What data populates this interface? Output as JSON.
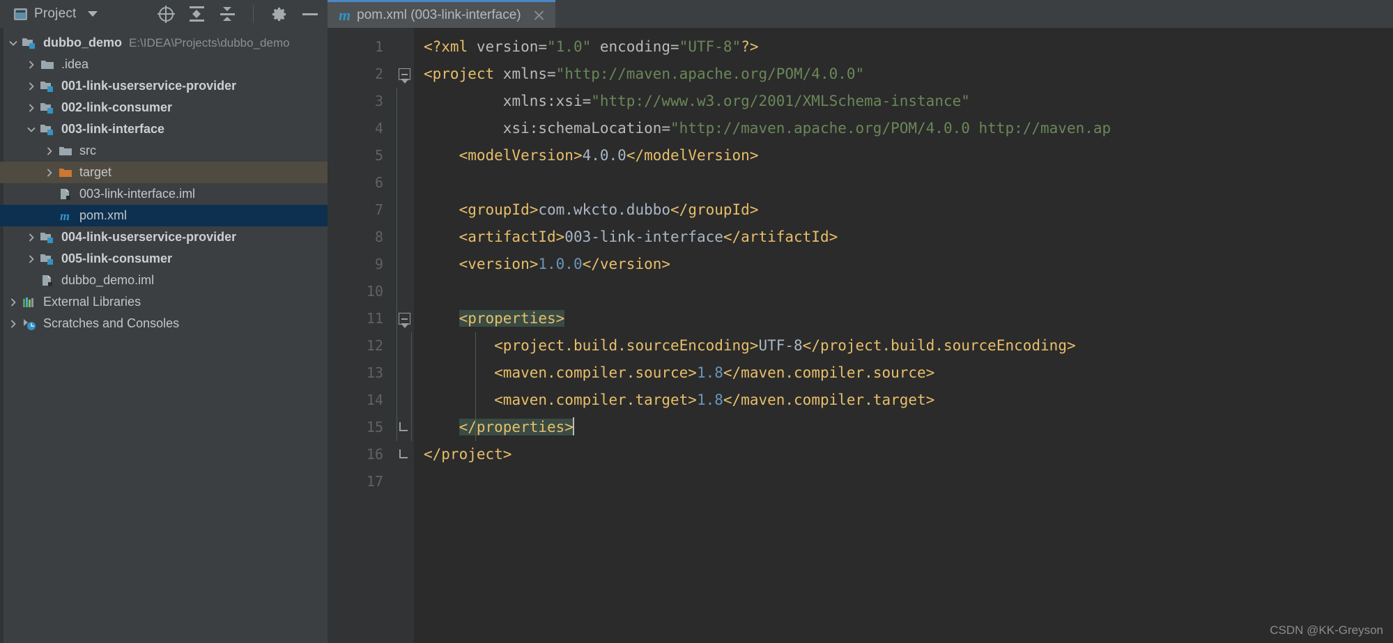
{
  "tool_window": {
    "title": "Project",
    "icons": [
      {
        "name": "locate-icon",
        "label": "Select Opened File"
      },
      {
        "name": "expand-all-icon",
        "label": "Expand All"
      },
      {
        "name": "collapse-all-icon",
        "label": "Collapse All"
      },
      {
        "name": "gear-icon",
        "label": "Options"
      },
      {
        "name": "minimize-icon",
        "label": "Hide"
      }
    ]
  },
  "tab": {
    "icon": "maven-m-icon",
    "letter": "m",
    "label": "pom.xml (003-link-interface)",
    "close_label": "×"
  },
  "tree": {
    "items": [
      {
        "depth": 0,
        "arrow": "down",
        "icon": "module-folder-icon",
        "label": "dubbo_demo",
        "bold": true,
        "suffix": "E:\\IDEA\\Projects\\dubbo_demo",
        "state": "normal"
      },
      {
        "depth": 1,
        "arrow": "right",
        "icon": "folder-icon",
        "label": ".idea",
        "bold": false,
        "suffix": "",
        "state": "normal"
      },
      {
        "depth": 1,
        "arrow": "right",
        "icon": "module-folder-icon",
        "label": "001-link-userservice-provider",
        "bold": true,
        "suffix": "",
        "state": "normal"
      },
      {
        "depth": 1,
        "arrow": "right",
        "icon": "module-folder-icon",
        "label": "002-link-consumer",
        "bold": true,
        "suffix": "",
        "state": "normal"
      },
      {
        "depth": 1,
        "arrow": "down",
        "icon": "module-folder-icon",
        "label": "003-link-interface",
        "bold": true,
        "suffix": "",
        "state": "normal"
      },
      {
        "depth": 2,
        "arrow": "right",
        "icon": "folder-icon",
        "label": "src",
        "bold": false,
        "suffix": "",
        "state": "normal"
      },
      {
        "depth": 2,
        "arrow": "right",
        "icon": "folder-orange-icon",
        "label": "target",
        "bold": false,
        "suffix": "",
        "state": "target-highlight"
      },
      {
        "depth": 2,
        "arrow": "none",
        "icon": "iml-file-icon",
        "label": "003-link-interface.iml",
        "bold": false,
        "suffix": "",
        "state": "normal"
      },
      {
        "depth": 2,
        "arrow": "none",
        "icon": "maven-m-icon",
        "label": "pom.xml",
        "bold": false,
        "suffix": "",
        "state": "selected"
      },
      {
        "depth": 1,
        "arrow": "right",
        "icon": "module-folder-icon",
        "label": "004-link-userservice-provider",
        "bold": true,
        "suffix": "",
        "state": "normal"
      },
      {
        "depth": 1,
        "arrow": "right",
        "icon": "module-folder-icon",
        "label": "005-link-consumer",
        "bold": true,
        "suffix": "",
        "state": "normal"
      },
      {
        "depth": 1,
        "arrow": "none",
        "icon": "iml-file-icon",
        "label": "dubbo_demo.iml",
        "bold": false,
        "suffix": "",
        "state": "normal"
      },
      {
        "depth": 0,
        "arrow": "right",
        "icon": "external-libraries-icon",
        "label": "External Libraries",
        "bold": false,
        "suffix": "",
        "state": "normal"
      },
      {
        "depth": 0,
        "arrow": "right",
        "icon": "scratches-icon",
        "label": "Scratches and Consoles",
        "bold": false,
        "suffix": "",
        "state": "normal"
      }
    ]
  },
  "editor": {
    "line_numbers": [
      "1",
      "2",
      "3",
      "4",
      "5",
      "6",
      "7",
      "8",
      "9",
      "10",
      "11",
      "12",
      "13",
      "14",
      "15",
      "16",
      "17"
    ],
    "lines": [
      [
        {
          "t": "pi",
          "v": "<?xml "
        },
        {
          "t": "attr",
          "v": "version="
        },
        {
          "t": "str",
          "v": "\"1.0\""
        },
        {
          "t": "attr",
          "v": " encoding="
        },
        {
          "t": "str",
          "v": "\"UTF-8\""
        },
        {
          "t": "pi",
          "v": "?>"
        }
      ],
      [
        {
          "t": "tag",
          "v": "<project "
        },
        {
          "t": "attr",
          "v": "xmlns="
        },
        {
          "t": "str",
          "v": "\"http://maven.apache.org/POM/4.0.0\""
        }
      ],
      [
        {
          "t": "txt",
          "v": "         "
        },
        {
          "t": "attr",
          "v": "xmlns:xsi="
        },
        {
          "t": "str",
          "v": "\"http://www.w3.org/2001/XMLSchema-instance\""
        }
      ],
      [
        {
          "t": "txt",
          "v": "         "
        },
        {
          "t": "attr",
          "v": "xsi:schemaLocation="
        },
        {
          "t": "str",
          "v": "\"http://maven.apache.org/POM/4.0.0 http://maven.ap"
        }
      ],
      [
        {
          "t": "txt",
          "v": "    "
        },
        {
          "t": "tag",
          "v": "<modelVersion>"
        },
        {
          "t": "txt",
          "v": "4.0.0"
        },
        {
          "t": "tag",
          "v": "</modelVersion>"
        }
      ],
      [],
      [
        {
          "t": "txt",
          "v": "    "
        },
        {
          "t": "tag",
          "v": "<groupId>"
        },
        {
          "t": "txt",
          "v": "com.wkcto.dubbo"
        },
        {
          "t": "tag",
          "v": "</groupId>"
        }
      ],
      [
        {
          "t": "txt",
          "v": "    "
        },
        {
          "t": "tag",
          "v": "<artifactId>"
        },
        {
          "t": "txt",
          "v": "003-link-interface"
        },
        {
          "t": "tag",
          "v": "</artifactId>"
        }
      ],
      [
        {
          "t": "txt",
          "v": "    "
        },
        {
          "t": "tag",
          "v": "<version>"
        },
        {
          "t": "num",
          "v": "1.0.0"
        },
        {
          "t": "tag",
          "v": "</version>"
        }
      ],
      [],
      [
        {
          "t": "txt",
          "v": "    "
        },
        {
          "t": "tag hl",
          "v": "<properties>"
        }
      ],
      [
        {
          "t": "txt",
          "v": "        "
        },
        {
          "t": "tag",
          "v": "<project.build.sourceEncoding>"
        },
        {
          "t": "txt",
          "v": "UTF-8"
        },
        {
          "t": "tag",
          "v": "</project.build.sourceEncoding>"
        }
      ],
      [
        {
          "t": "txt",
          "v": "        "
        },
        {
          "t": "tag",
          "v": "<maven.compiler.source>"
        },
        {
          "t": "num",
          "v": "1.8"
        },
        {
          "t": "tag",
          "v": "</maven.compiler.source>"
        }
      ],
      [
        {
          "t": "txt",
          "v": "        "
        },
        {
          "t": "tag",
          "v": "<maven.compiler.target>"
        },
        {
          "t": "num",
          "v": "1.8"
        },
        {
          "t": "tag",
          "v": "</maven.compiler.target>"
        }
      ],
      [
        {
          "t": "txt",
          "v": "    "
        },
        {
          "t": "tag hl",
          "v": "</properties>"
        },
        {
          "t": "caret",
          "v": ""
        }
      ],
      [
        {
          "t": "tag",
          "v": "</project>"
        }
      ],
      []
    ]
  },
  "watermark": {
    "text": "CSDN @KK-Greyson"
  },
  "colors": {
    "ui_bg": "#3c3f41",
    "editor_bg": "#2b2b2b",
    "gutter_bg": "#313335",
    "tab_active_bg": "#4e5254",
    "tab_underline": "#4a88c7",
    "selection_bg": "#0d3050",
    "target_row_bg": "#4f4b41",
    "tag": "#e8bf6a",
    "string": "#6a8759",
    "number": "#6897bb",
    "text": "#a9b7c6",
    "attr": "#bababa",
    "match_highlight": "#3a4b43"
  }
}
